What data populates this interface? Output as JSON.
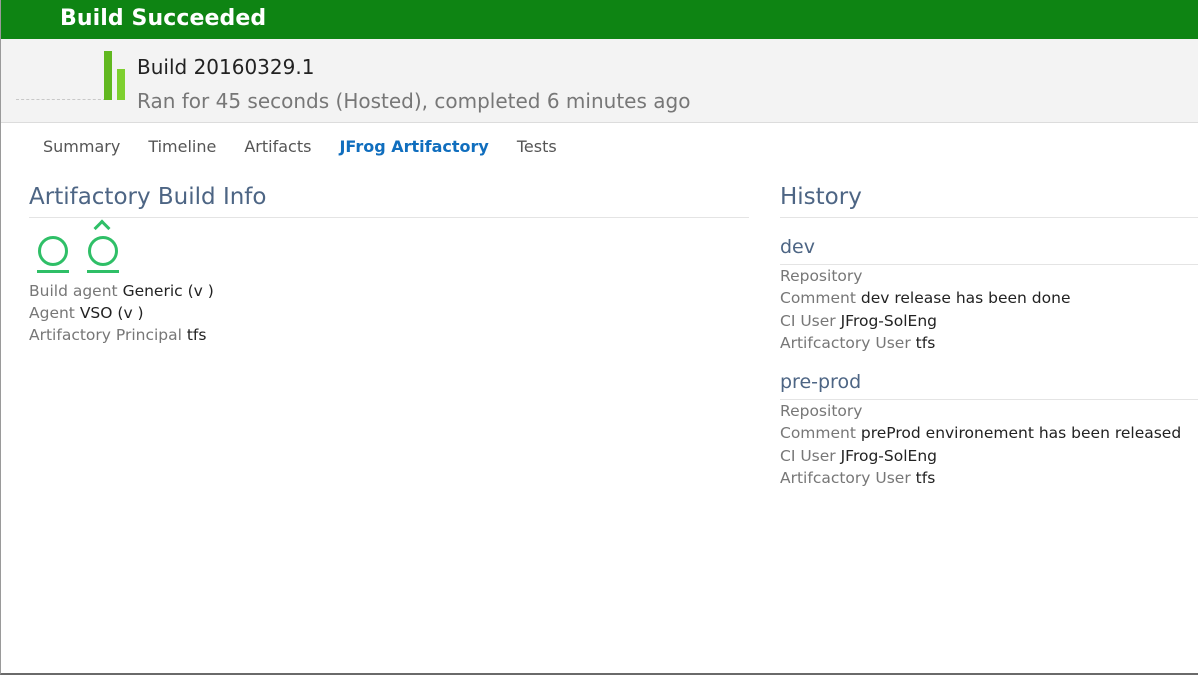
{
  "banner": {
    "title": "Build Succeeded"
  },
  "build": {
    "name": "Build 20160329.1",
    "summary": "Ran for 45 seconds (Hosted), completed 6 minutes ago",
    "bar_colors": [
      "#61b820",
      "#7ed02f"
    ]
  },
  "tabs": [
    {
      "label": "Summary",
      "active": false
    },
    {
      "label": "Timeline",
      "active": false
    },
    {
      "label": "Artifacts",
      "active": false
    },
    {
      "label": "JFrog Artifactory",
      "active": true
    },
    {
      "label": "Tests",
      "active": false
    }
  ],
  "build_info": {
    "title": "Artifactory Build Info",
    "icons": [
      "o-underline-icon",
      "o-circumflex-underline-icon"
    ],
    "rows": [
      {
        "key": "Build agent",
        "value": "Generic (v )"
      },
      {
        "key": "Agent",
        "value": "VSO (v )"
      },
      {
        "key": "Artifactory Principal",
        "value": "tfs"
      }
    ]
  },
  "history": {
    "title": "History",
    "entries": [
      {
        "name": "dev",
        "rows": [
          {
            "key": "Repository",
            "value": ""
          },
          {
            "key": "Comment",
            "value": "dev release has been done"
          },
          {
            "key": "CI User",
            "value": "JFrog-SolEng"
          },
          {
            "key": "Artifcactory User",
            "value": "tfs"
          }
        ]
      },
      {
        "name": "pre-prod",
        "rows": [
          {
            "key": "Repository",
            "value": ""
          },
          {
            "key": "Comment",
            "value": "preProd environement has been released"
          },
          {
            "key": "CI User",
            "value": "JFrog-SolEng"
          },
          {
            "key": "Artifcactory User",
            "value": "tfs"
          }
        ]
      }
    ]
  },
  "colors": {
    "banner": "#0e8413",
    "accent_tab": "#106ebe",
    "section_title": "#4d6584",
    "icon_green": "#2fbf67"
  }
}
